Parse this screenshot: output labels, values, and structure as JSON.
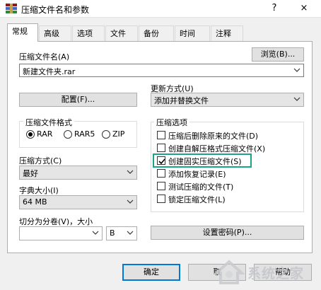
{
  "window": {
    "title": "压缩文件名和参数",
    "help": "?",
    "close": "×"
  },
  "tabs": [
    "常规",
    "高级",
    "选项",
    "文件",
    "备份",
    "时间",
    "注释"
  ],
  "archive_name": {
    "label": "压缩文件名(A)",
    "browse": "浏览(B)...",
    "value": "新建文件夹.rar"
  },
  "profiles_button": "配置(F)...",
  "update_mode": {
    "label": "更新方式(U)",
    "value": "添加并替换文件"
  },
  "format": {
    "label": "压缩文件格式",
    "options": [
      "RAR",
      "RAR5",
      "ZIP"
    ],
    "selected": "RAR"
  },
  "method": {
    "label": "压缩方式(C)",
    "value": "最好"
  },
  "dictionary": {
    "label": "字典大小(I)",
    "value": "64 MB"
  },
  "split": {
    "label": "切分为分卷(V)，大小",
    "value": "",
    "unit": "B"
  },
  "options": {
    "label": "压缩选项",
    "items": [
      {
        "label": "压缩后删除原来的文件(D)",
        "checked": false
      },
      {
        "label": "创建自解压格式压缩文件(X)",
        "checked": false
      },
      {
        "label": "创建固实压缩文件(S)",
        "checked": true
      },
      {
        "label": "添加恢复记录(E)",
        "checked": false
      },
      {
        "label": "测试压缩的文件(T)",
        "checked": false
      },
      {
        "label": "锁定压缩文件(L)",
        "checked": false
      }
    ]
  },
  "password_button": "设置密码(P)...",
  "footer": {
    "ok": "确定",
    "cancel": "取",
    "help": "帮助"
  },
  "watermark": "系统之家"
}
